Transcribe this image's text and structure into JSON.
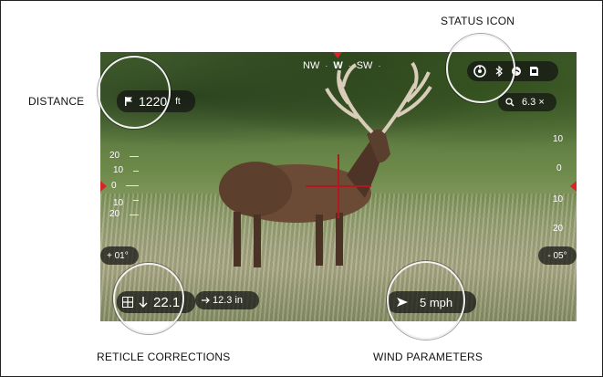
{
  "callouts": {
    "status_icon": "STATUS ICON",
    "distance": "DISTANCE",
    "reticle_corrections": "RETICLE CORRECTIONS",
    "wind_parameters": "WIND PARAMETERS"
  },
  "compass": {
    "left": "NW",
    "heading": "W",
    "right": "SW"
  },
  "status_bar": {
    "icons": [
      "ballistic-status-icon",
      "bluetooth-icon",
      "wifi-icon",
      "sd-card-icon"
    ]
  },
  "zoom": {
    "value": "6.3 ×"
  },
  "distance": {
    "value": "1220",
    "unit": "ft"
  },
  "scale_left": {
    "labels": [
      "20",
      "10",
      "0",
      "10",
      "20"
    ]
  },
  "scale_right": {
    "labels": [
      "10",
      "0",
      "10",
      "20"
    ]
  },
  "tilt": {
    "left": "+ 01°",
    "right": "- 05°"
  },
  "reticle_correction": {
    "value": "22.1",
    "sub_value": "12.3 in"
  },
  "wind": {
    "value": "5 mph"
  },
  "colors": {
    "reticle": "#b01a1d",
    "marker": "#d5262a",
    "hud_background": "#141414"
  }
}
